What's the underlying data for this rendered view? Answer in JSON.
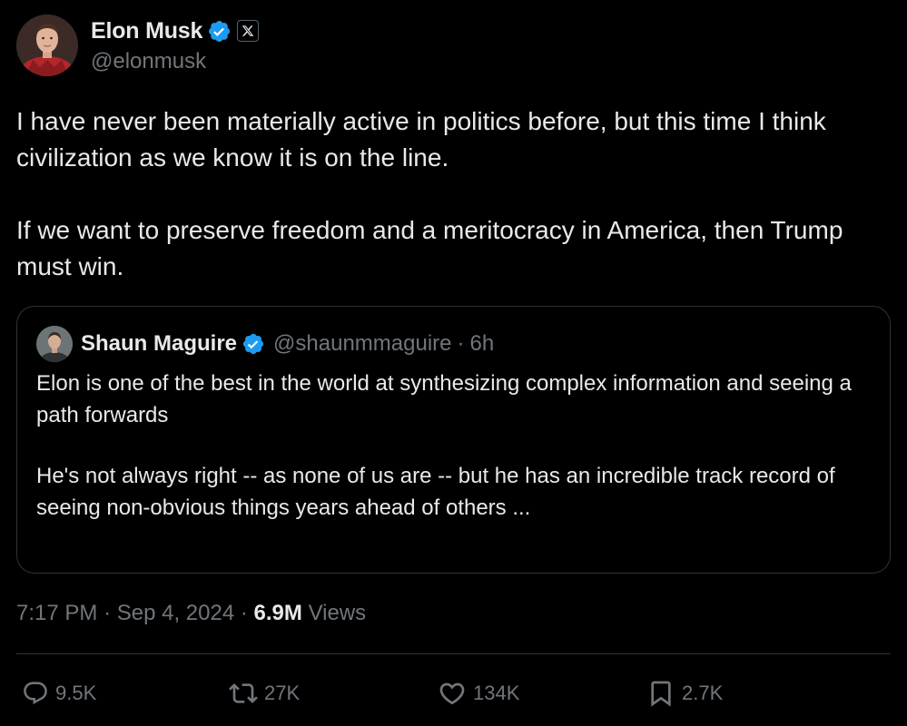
{
  "author": {
    "display_name": "Elon Musk",
    "handle": "@elonmusk",
    "verified_icon": "verified-badge-icon",
    "affiliate_icon": "x-logo-icon"
  },
  "tweet": {
    "paragraphs": [
      "I have never been materially active in politics before, but this time I think civilization as we know it is on the line.",
      "If we want to preserve freedom and a meritocracy in America, then Trump must win."
    ]
  },
  "quote": {
    "display_name": "Shaun Maguire",
    "handle": "@shaunmmaguire",
    "separator": "·",
    "time": "6h",
    "paragraphs": [
      "Elon is one of the best in the world at synthesizing complex information and seeing a path forwards",
      "He's not always right -- as none of us are -- but he has an incredible track record of seeing non-obvious things years ahead of others ..."
    ]
  },
  "meta": {
    "time": "7:17 PM",
    "separator": "·",
    "date": "Sep 4, 2024",
    "views_count": "6.9M",
    "views_label": "Views"
  },
  "actions": {
    "reply": {
      "icon": "reply-icon",
      "count": "9.5K"
    },
    "retweet": {
      "icon": "retweet-icon",
      "count": "27K"
    },
    "like": {
      "icon": "heart-icon",
      "count": "134K"
    },
    "bookmark": {
      "icon": "bookmark-icon",
      "count": "2.7K"
    }
  },
  "colors": {
    "background": "#000000",
    "text_primary": "#e7e9ea",
    "text_secondary": "#71767b",
    "border": "#2f3336",
    "verified_blue": "#1d9bf0"
  }
}
